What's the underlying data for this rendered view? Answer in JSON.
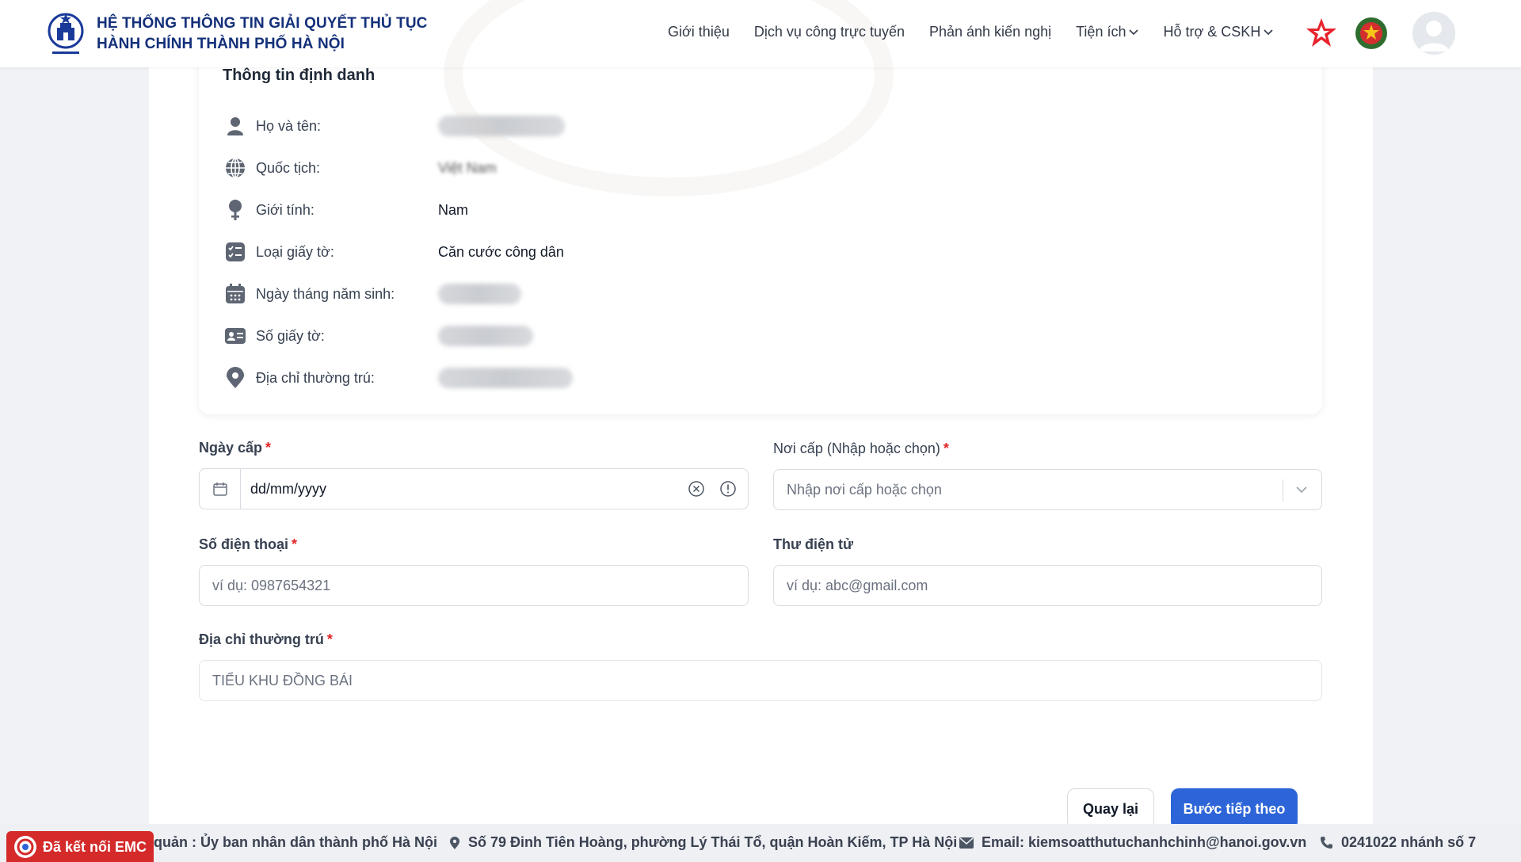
{
  "header": {
    "brand_line1": "HỆ THỐNG THÔNG TIN GIẢI QUYẾT THỦ TỤC",
    "brand_line2": "HÀNH CHÍNH THÀNH PHỐ HÀ NỘI",
    "nav": [
      {
        "label": "Giới thiệu"
      },
      {
        "label": "Dịch vụ công trực tuyến"
      },
      {
        "label": "Phản ánh kiến nghị"
      },
      {
        "label": "Tiện ích"
      },
      {
        "label": "Hỗ trợ & CSKH"
      }
    ]
  },
  "id_card": {
    "title": "Thông tin định danh",
    "rows": [
      {
        "label": "Họ và tên:",
        "icon": "person-icon"
      },
      {
        "label": "Quốc tịch:",
        "icon": "globe-icon",
        "value": "Việt Nam"
      },
      {
        "label": "Giới tính:",
        "icon": "gender-icon",
        "value": "Nam"
      },
      {
        "label": "Loại giấy tờ:",
        "icon": "checklist-icon",
        "value": "Căn cước công dân"
      },
      {
        "label": "Ngày tháng năm sinh:",
        "icon": "calendar-icon"
      },
      {
        "label": "Số giấy tờ:",
        "icon": "id-card-icon"
      },
      {
        "label": "Địa chỉ thường trú:",
        "icon": "location-icon"
      }
    ]
  },
  "form": {
    "issue_date": {
      "label": "Ngày cấp",
      "value": "dd/mm/yyyy"
    },
    "issue_place": {
      "label": "Nơi cấp (Nhập hoặc chọn)",
      "placeholder": "Nhập nơi cấp hoặc chọn"
    },
    "phone": {
      "label": "Số điện thoại",
      "placeholder": "ví dụ: 0987654321"
    },
    "email": {
      "label": "Thư điện tử",
      "placeholder": "ví dụ: abc@gmail.com"
    },
    "address": {
      "label": "Địa chỉ thường trú",
      "value": "TIỂU KHU ĐỒNG BÁI"
    },
    "required_mark": "*"
  },
  "buttons": {
    "back": "Quay lại",
    "next": "Bước tiếp theo"
  },
  "footer": {
    "agency": "quản : Ủy ban nhân dân thành phố Hà Nội",
    "address": "Số 79 Đinh Tiên Hoàng, phường Lý Thái Tổ, quận Hoàn Kiếm, TP Hà Nội",
    "email": "Email: kiemsoatthutuchanhchinh@hanoi.gov.vn",
    "phone": "0241022 nhánh số 7"
  },
  "emc_badge": "Đã kết nối EMC",
  "colors": {
    "brand_navy": "#14307a",
    "primary_blue": "#2d65d8",
    "required_red": "#e02424",
    "emc_red": "#d42a2a"
  }
}
